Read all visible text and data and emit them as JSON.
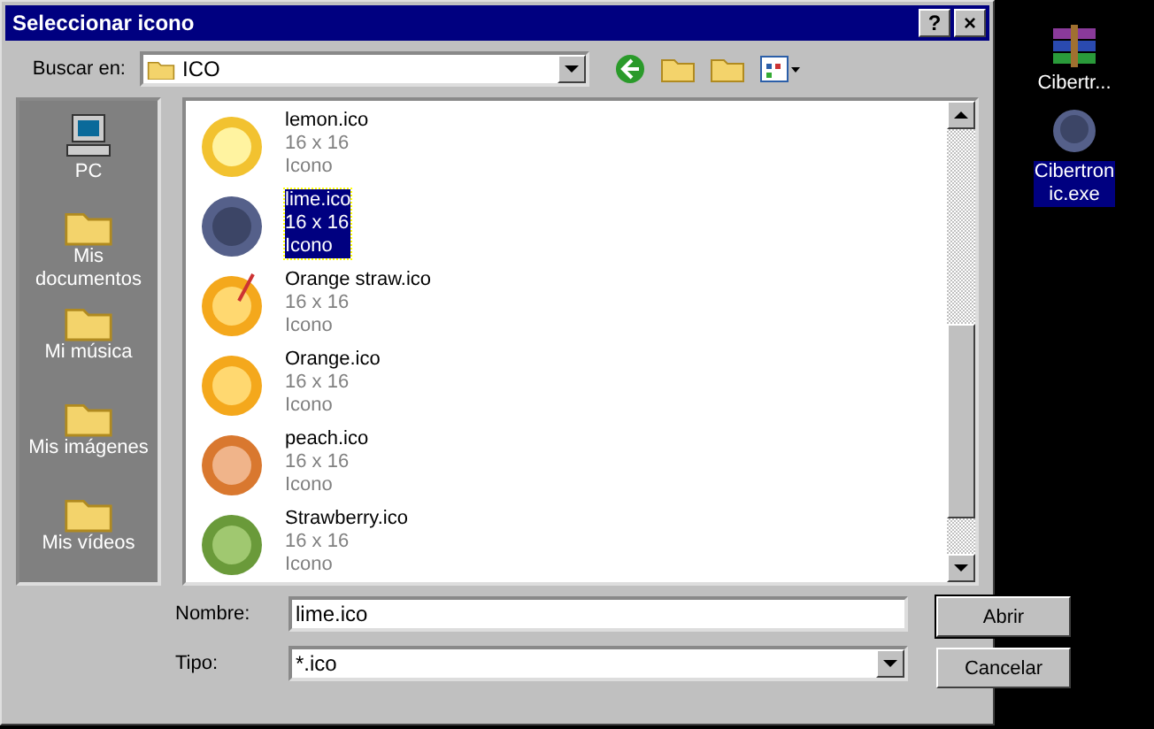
{
  "window": {
    "title": "Seleccionar icono",
    "title_buttons": [
      "?",
      "×"
    ]
  },
  "look_in": {
    "label": "Buscar en:",
    "value": "ICO"
  },
  "places": [
    {
      "label": "PC",
      "kind": "pc"
    },
    {
      "label": "Mis documentos",
      "kind": "docs"
    },
    {
      "label": "Mi música",
      "kind": "music"
    },
    {
      "label": "Mis imágenes",
      "kind": "images"
    },
    {
      "label": "Mis vídeos",
      "kind": "videos"
    }
  ],
  "files": [
    {
      "name": "lemon.ico",
      "size": "16 x 16",
      "type": "Icono",
      "kind": "lemon",
      "selected": false
    },
    {
      "name": "lime.ico",
      "size": "16 x 16",
      "type": "Icono",
      "kind": "lime",
      "selected": true
    },
    {
      "name": "Orange straw.ico",
      "size": "16 x 16",
      "type": "Icono",
      "kind": "straw",
      "selected": false
    },
    {
      "name": "Orange.ico",
      "size": "16 x 16",
      "type": "Icono",
      "kind": "orange",
      "selected": false
    },
    {
      "name": "peach.ico",
      "size": "16 x 16",
      "type": "Icono",
      "kind": "peach",
      "selected": false
    },
    {
      "name": "Strawberry.ico",
      "size": "16 x 16",
      "type": "Icono",
      "kind": "strawberry",
      "selected": false
    }
  ],
  "name_field": {
    "label": "Nombre:",
    "value": "lime.ico"
  },
  "type_field": {
    "label": "Tipo:",
    "value": "*.ico"
  },
  "buttons": [
    "Abrir",
    "Cancelar"
  ],
  "desktop": [
    {
      "label": "Cibertr...",
      "kind": "archive",
      "selected": false
    },
    {
      "label": "Cibertronic.exe",
      "kind": "lime",
      "selected": true
    }
  ]
}
